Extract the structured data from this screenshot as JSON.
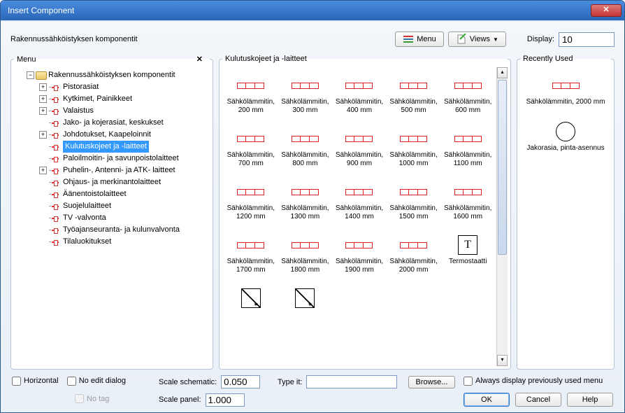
{
  "window": {
    "title": "Insert Component"
  },
  "header": {
    "subtitle": "Rakennussähköistyksen komponentit",
    "menu_btn": "Menu",
    "views_btn": "Views",
    "display_label": "Display:",
    "display_value": "10"
  },
  "menu_panel": {
    "legend": "Menu",
    "root": "Rakennussähköistyksen komponentit",
    "items": [
      {
        "label": "Pistorasiat",
        "expandable": true
      },
      {
        "label": "Kytkimet, Painikkeet",
        "expandable": true
      },
      {
        "label": "Valaistus",
        "expandable": true
      },
      {
        "label": "Jako- ja kojerasiat, keskukset",
        "expandable": false
      },
      {
        "label": "Johdotukset, Kaapeloinnit",
        "expandable": true
      },
      {
        "label": "Kulutuskojeet ja -laitteet",
        "expandable": false,
        "selected": true
      },
      {
        "label": "Paloilmoitin- ja savunpoistolaitteet",
        "expandable": false
      },
      {
        "label": "Puhelin-, Antenni- ja ATK- laitteet",
        "expandable": true
      },
      {
        "label": "Ohjaus- ja merkinantolaitteet",
        "expandable": false
      },
      {
        "label": "Äänentoistolaitteet",
        "expandable": false
      },
      {
        "label": "Suojelulaitteet",
        "expandable": false
      },
      {
        "label": "TV -valvonta",
        "expandable": false
      },
      {
        "label": "Työajanseuranta- ja kulunvalvonta",
        "expandable": false
      },
      {
        "label": "Tilaluokitukset",
        "expandable": false
      }
    ]
  },
  "center_panel": {
    "legend": "Kulutuskojeet ja -laitteet",
    "items": [
      {
        "name": "Sähkölämmitin, 200 mm",
        "type": "heater"
      },
      {
        "name": "Sähkölämmitin, 300 mm",
        "type": "heater"
      },
      {
        "name": "Sähkölämmitin, 400 mm",
        "type": "heater"
      },
      {
        "name": "Sähkölämmitin, 500 mm",
        "type": "heater"
      },
      {
        "name": "Sähkölämmitin, 600 mm",
        "type": "heater"
      },
      {
        "name": "Sähkölämmitin, 700 mm",
        "type": "heater"
      },
      {
        "name": "Sähkölämmitin, 800 mm",
        "type": "heater"
      },
      {
        "name": "Sähkölämmitin, 900 mm",
        "type": "heater"
      },
      {
        "name": "Sähkölämmitin, 1000 mm",
        "type": "heater"
      },
      {
        "name": "Sähkölämmitin, 1100 mm",
        "type": "heater"
      },
      {
        "name": "Sähkölämmitin, 1200 mm",
        "type": "heater"
      },
      {
        "name": "Sähkölämmitin, 1300 mm",
        "type": "heater"
      },
      {
        "name": "Sähkölämmitin, 1400 mm",
        "type": "heater"
      },
      {
        "name": "Sähkölämmitin, 1500 mm",
        "type": "heater"
      },
      {
        "name": "Sähkölämmitin, 1600 mm",
        "type": "heater"
      },
      {
        "name": "Sähkölämmitin, 1700 mm",
        "type": "heater"
      },
      {
        "name": "Sähkölämmitin, 1800 mm",
        "type": "heater"
      },
      {
        "name": "Sähkölämmitin, 1900 mm",
        "type": "heater"
      },
      {
        "name": "Sähkölämmitin, 2000 mm",
        "type": "heater"
      },
      {
        "name": "Termostaatti",
        "type": "thermo"
      },
      {
        "name": "",
        "type": "meter"
      },
      {
        "name": "",
        "type": "meter"
      }
    ]
  },
  "recent_panel": {
    "legend": "Recently Used",
    "items": [
      {
        "name": "Sähkölämmitin, 2000 mm",
        "type": "heater"
      },
      {
        "name": "Jakorasia, pinta-asennus",
        "type": "circle"
      }
    ]
  },
  "bottom": {
    "horizontal": "Horizontal",
    "noedit": "No edit dialog",
    "notag": "No tag",
    "scale_schematic_label": "Scale schematic:",
    "scale_schematic_value": "0.050",
    "scale_panel_label": "Scale panel:",
    "scale_panel_value": "1.000",
    "typeit_label": "Type it:",
    "typeit_value": "",
    "browse": "Browse...",
    "always": "Always display previously used menu",
    "ok": "OK",
    "cancel": "Cancel",
    "help": "Help"
  }
}
